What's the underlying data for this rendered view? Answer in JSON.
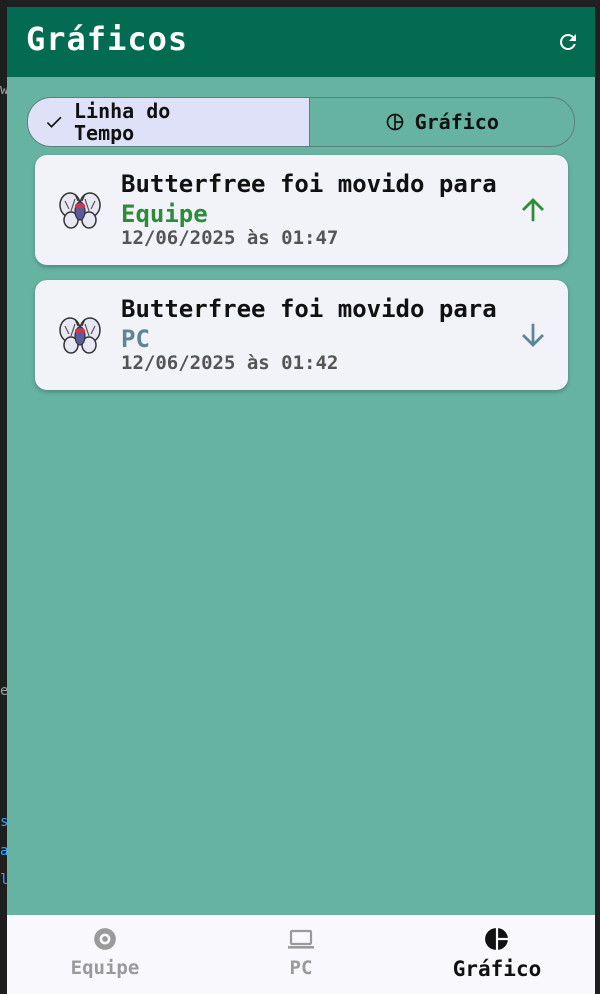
{
  "app": {
    "title": "Gráficos"
  },
  "colors": {
    "top_bar": "#036b52",
    "background": "#67b3a2",
    "equipe_text": "#2e8b3a",
    "pc_text": "#5e8596",
    "up_arrow": "#2e8b3a",
    "down_arrow": "#5e8596"
  },
  "view_toggle": {
    "options": [
      {
        "label_line1": "Linha do",
        "label_line2": "Tempo",
        "icon": "check-icon",
        "selected": true
      },
      {
        "label": "Gráfico",
        "icon": "pie-chart-icon",
        "selected": false
      }
    ]
  },
  "events": [
    {
      "pokemon": "Butterfree",
      "text_prefix": "Butterfree foi movido para",
      "destination": "Equipe",
      "timestamp": "12/06/2025 às 01:47",
      "direction": "up",
      "sprite": "butterfree-sprite"
    },
    {
      "pokemon": "Butterfree",
      "text_prefix": "Butterfree foi movido para",
      "destination": "PC",
      "timestamp": "12/06/2025 às 01:42",
      "direction": "down",
      "sprite": "butterfree-sprite"
    }
  ],
  "bottom_nav": {
    "items": [
      {
        "label": "Equipe",
        "icon": "pokeball-icon",
        "active": false
      },
      {
        "label": "PC",
        "icon": "laptop-icon",
        "active": false
      },
      {
        "label": "Gráfico",
        "icon": "pie-chart-icon",
        "active": true
      }
    ]
  },
  "edge_text": [
    "w",
    "e",
    "s",
    "a",
    "l"
  ]
}
